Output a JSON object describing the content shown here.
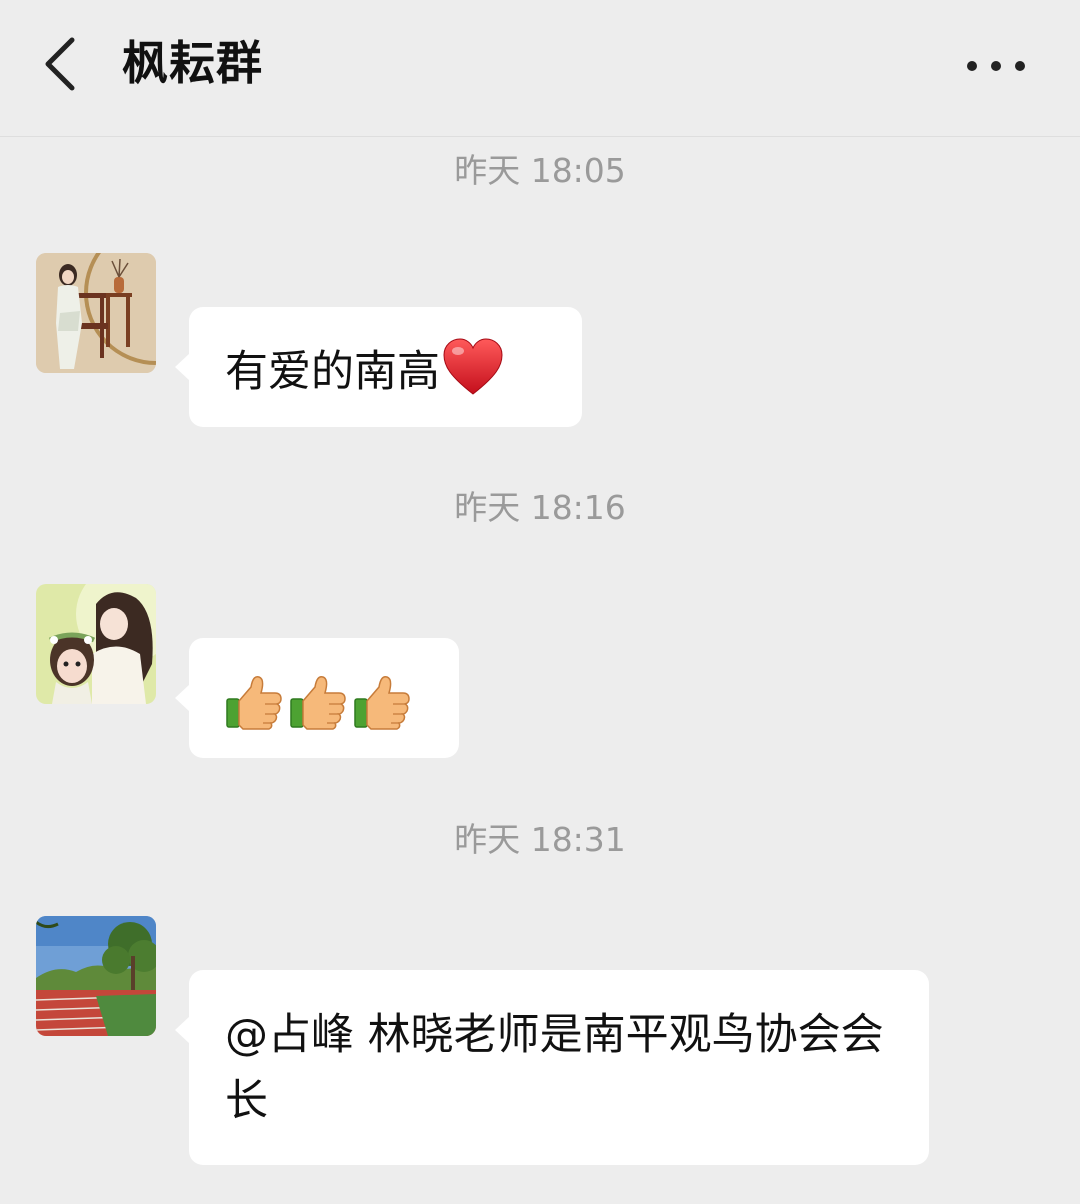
{
  "header": {
    "title": "枫耘群",
    "back_icon": "chevron-left-icon",
    "more_icon": "more-dots-icon"
  },
  "messages": [
    {
      "time": "昨天 18:05",
      "text": "有爱的南高",
      "emoji": "red-heart-icon"
    },
    {
      "time": "昨天 18:16",
      "emojis": [
        "thumbs-up-icon",
        "thumbs-up-icon",
        "thumbs-up-icon"
      ]
    },
    {
      "time": "昨天 18:31",
      "text": "@占峰  林晓老师是南平观鸟协会会长"
    }
  ],
  "colors": {
    "background": "#ededed",
    "bubble": "#ffffff",
    "timestamp": "#9a9a9a"
  }
}
